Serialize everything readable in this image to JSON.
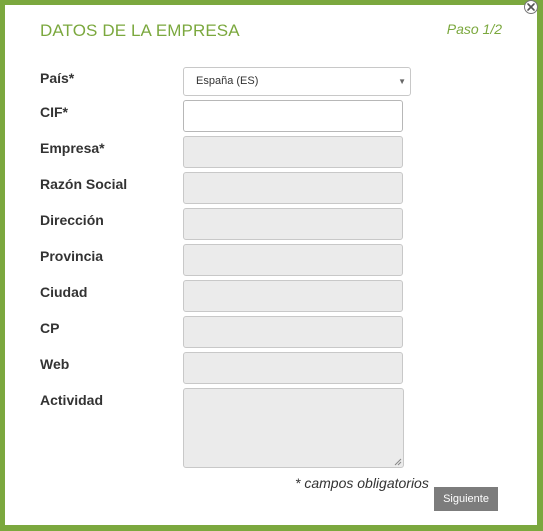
{
  "header": {
    "title": "DATOS DE LA EMPRESA",
    "step": "Paso 1/2"
  },
  "form": {
    "pais": {
      "label": "País*",
      "selected": "España (ES)"
    },
    "cif": {
      "label": "CIF*",
      "value": ""
    },
    "empresa": {
      "label": "Empresa*",
      "value": ""
    },
    "razon_social": {
      "label": "Razón Social",
      "value": ""
    },
    "direccion": {
      "label": "Dirección",
      "value": ""
    },
    "provincia": {
      "label": "Provincia",
      "value": ""
    },
    "ciudad": {
      "label": "Ciudad",
      "value": ""
    },
    "cp": {
      "label": "CP",
      "value": ""
    },
    "web": {
      "label": "Web",
      "value": ""
    },
    "actividad": {
      "label": "Actividad",
      "value": ""
    }
  },
  "footer": {
    "required_note": "* campos obligatorios",
    "next_label": "Siguiente"
  },
  "icons": {
    "close": "close-icon",
    "dropdown": "chevron-down-icon",
    "resize": "resize-grip-icon"
  },
  "colors": {
    "accent": "#7ba83e",
    "disabled_field": "#ebebeb",
    "button": "#7c7c7c"
  }
}
